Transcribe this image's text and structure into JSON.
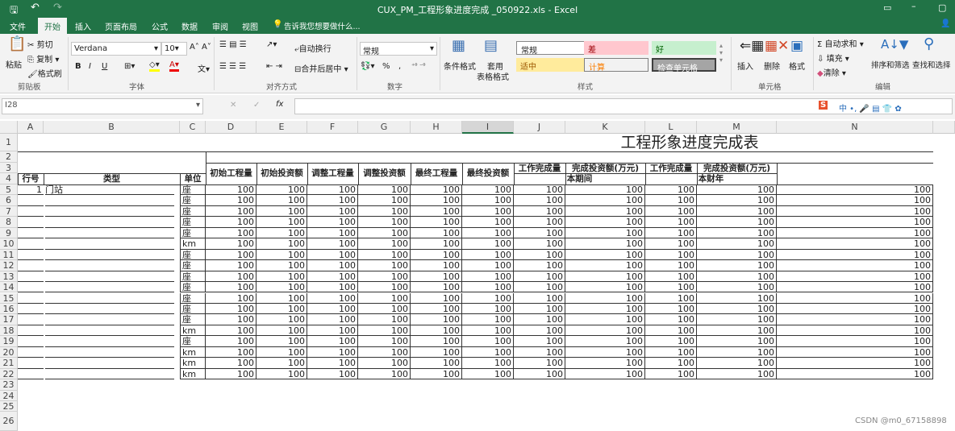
{
  "window": {
    "title": "CUX_PM_工程形象进度完成 _050922.xls - Excel"
  },
  "tabs": [
    "文件",
    "开始",
    "插入",
    "页面布局",
    "公式",
    "数据",
    "审阅",
    "视图"
  ],
  "tell_me": "告诉我您想要做什么...",
  "ribbon": {
    "clipboard": {
      "paste": "粘贴",
      "cut": "剪切",
      "copy": "复制",
      "format_painter": "格式刷",
      "label": "剪贴板"
    },
    "font": {
      "name": "Verdana",
      "size": "10",
      "bold": "B",
      "italic": "I",
      "underline": "U",
      "label": "字体"
    },
    "alignment": {
      "wrap": "自动换行",
      "merge": "合并后居中",
      "label": "对齐方式"
    },
    "number": {
      "format": "常规",
      "percent": "%",
      "comma": ",",
      "label": "数字"
    },
    "styles": {
      "conditional": "条件格式",
      "table_format_1": "套用",
      "table_format_2": "表格格式",
      "cells": [
        "常规",
        "差",
        "好",
        "适中",
        "计算",
        "检查单元格"
      ],
      "label": "样式"
    },
    "cells": {
      "insert": "插入",
      "delete": "删除",
      "format": "格式",
      "label": "单元格"
    },
    "editing": {
      "autosum": "自动求和",
      "fill": "填充",
      "clear": "清除",
      "sort": "排序和筛选",
      "find": "查找和选择",
      "label": "编辑"
    }
  },
  "formula_bar": {
    "name_box": "I28",
    "value": ""
  },
  "columns": [
    "A",
    "B",
    "C",
    "D",
    "E",
    "F",
    "G",
    "H",
    "I",
    "J",
    "K",
    "L",
    "M",
    "N"
  ],
  "row_numbers": [
    "1",
    "2",
    "3",
    "4",
    "5",
    "6",
    "7",
    "8",
    "9",
    "10",
    "11",
    "12",
    "13",
    "14",
    "15",
    "16",
    "17",
    "18",
    "19",
    "20",
    "21",
    "22",
    "23",
    "24",
    "25",
    "26"
  ],
  "sheet": {
    "title": "工程形象进度完成表",
    "headers": {
      "no": "行号",
      "type": "类型",
      "unit": "单位",
      "D": "初始工程量",
      "E": "初始投资额",
      "F": "调整工程量",
      "G": "调整投资额",
      "H": "最终工程量",
      "I": "最终投资额",
      "J": "工作完成量",
      "K": "完成投资额(万元)",
      "L": "工作完成量",
      "M": "完成投资额(万元)",
      "period": "本期间",
      "fiscal": "本财年"
    },
    "rows": [
      {
        "no": "1",
        "type": "门站",
        "unit": "座",
        "values": [
          "100",
          "100",
          "100",
          "100",
          "100",
          "100",
          "100",
          "100",
          "100",
          "100",
          "100"
        ]
      },
      {
        "no": "",
        "type": "",
        "unit": "座",
        "values": [
          "100",
          "100",
          "100",
          "100",
          "100",
          "100",
          "100",
          "100",
          "100",
          "100",
          "100"
        ]
      },
      {
        "no": "",
        "type": "",
        "unit": "座",
        "values": [
          "100",
          "100",
          "100",
          "100",
          "100",
          "100",
          "100",
          "100",
          "100",
          "100",
          "100"
        ]
      },
      {
        "no": "",
        "type": "",
        "unit": "座",
        "values": [
          "100",
          "100",
          "100",
          "100",
          "100",
          "100",
          "100",
          "100",
          "100",
          "100",
          "100"
        ]
      },
      {
        "no": "",
        "type": "",
        "unit": "座",
        "values": [
          "100",
          "100",
          "100",
          "100",
          "100",
          "100",
          "100",
          "100",
          "100",
          "100",
          "100"
        ]
      },
      {
        "no": "",
        "type": "",
        "unit": "km",
        "values": [
          "100",
          "100",
          "100",
          "100",
          "100",
          "100",
          "100",
          "100",
          "100",
          "100",
          "100"
        ]
      },
      {
        "no": "",
        "type": "",
        "unit": "座",
        "values": [
          "100",
          "100",
          "100",
          "100",
          "100",
          "100",
          "100",
          "100",
          "100",
          "100",
          "100"
        ]
      },
      {
        "no": "",
        "type": "",
        "unit": "座",
        "values": [
          "100",
          "100",
          "100",
          "100",
          "100",
          "100",
          "100",
          "100",
          "100",
          "100",
          "100"
        ]
      },
      {
        "no": "",
        "type": "",
        "unit": "座",
        "values": [
          "100",
          "100",
          "100",
          "100",
          "100",
          "100",
          "100",
          "100",
          "100",
          "100",
          "100"
        ]
      },
      {
        "no": "",
        "type": "",
        "unit": "座",
        "values": [
          "100",
          "100",
          "100",
          "100",
          "100",
          "100",
          "100",
          "100",
          "100",
          "100",
          "100"
        ]
      },
      {
        "no": "",
        "type": "",
        "unit": "座",
        "values": [
          "100",
          "100",
          "100",
          "100",
          "100",
          "100",
          "100",
          "100",
          "100",
          "100",
          "100"
        ]
      },
      {
        "no": "",
        "type": "",
        "unit": "座",
        "values": [
          "100",
          "100",
          "100",
          "100",
          "100",
          "100",
          "100",
          "100",
          "100",
          "100",
          "100"
        ]
      },
      {
        "no": "",
        "type": "",
        "unit": "座",
        "values": [
          "100",
          "100",
          "100",
          "100",
          "100",
          "100",
          "100",
          "100",
          "100",
          "100",
          "100"
        ]
      },
      {
        "no": "",
        "type": "",
        "unit": "km",
        "values": [
          "100",
          "100",
          "100",
          "100",
          "100",
          "100",
          "100",
          "100",
          "100",
          "100",
          "100"
        ]
      },
      {
        "no": "",
        "type": "",
        "unit": "座",
        "values": [
          "100",
          "100",
          "100",
          "100",
          "100",
          "100",
          "100",
          "100",
          "100",
          "100",
          "100"
        ]
      },
      {
        "no": "",
        "type": "",
        "unit": "km",
        "values": [
          "100",
          "100",
          "100",
          "100",
          "100",
          "100",
          "100",
          "100",
          "100",
          "100",
          "100"
        ]
      },
      {
        "no": "",
        "type": "",
        "unit": "km",
        "values": [
          "100",
          "100",
          "100",
          "100",
          "100",
          "100",
          "100",
          "100",
          "100",
          "100",
          "100"
        ]
      },
      {
        "no": "",
        "type": "",
        "unit": "km",
        "values": [
          "100",
          "100",
          "100",
          "100",
          "100",
          "100",
          "100",
          "100",
          "100",
          "100",
          "100"
        ]
      }
    ]
  },
  "watermark": "CSDN @m0_67158898",
  "colors": {
    "excel_green": "#217346",
    "bad": "#ffc7ce",
    "good": "#c6efce",
    "neutral": "#ffeb9c"
  }
}
